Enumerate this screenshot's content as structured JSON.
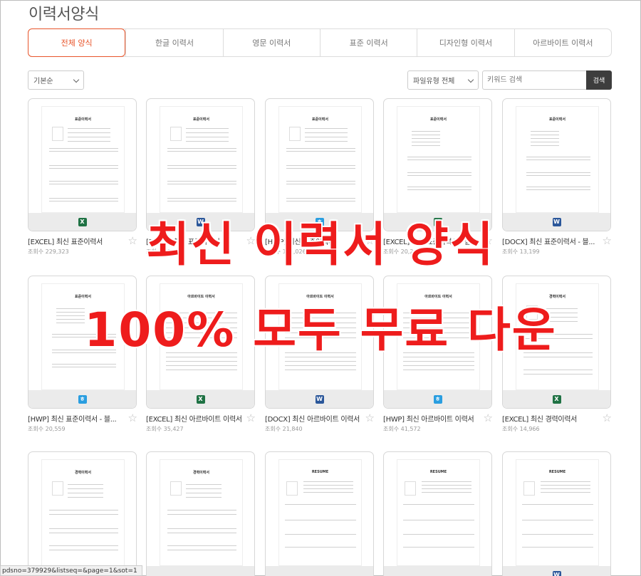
{
  "page": {
    "title": "이력서양식"
  },
  "tabs": [
    {
      "label": "전체 양식",
      "active": true
    },
    {
      "label": "한글 이력서",
      "active": false
    },
    {
      "label": "영문 이력서",
      "active": false
    },
    {
      "label": "표준 이력서",
      "active": false
    },
    {
      "label": "디자인형 이력서",
      "active": false
    },
    {
      "label": "아르바이트 이력서",
      "active": false
    }
  ],
  "controls": {
    "sort": "기본순",
    "file_type": "파일유형 전체",
    "search_placeholder": "키워드 검색",
    "search_button": "검색"
  },
  "colors": {
    "accent": "#e8552b",
    "excel": "#1f7244",
    "word": "#2b579a",
    "hwp": "#2a9ee0",
    "overlay": "#ee1c1c"
  },
  "cards": [
    {
      "title": "[EXCEL] 최신 표준이력서",
      "views": "조회수 229,323",
      "filetype": "excel",
      "doc_title": "표준이력서",
      "style": "std"
    },
    {
      "title": "[DOCX] 최신 표준이력서",
      "views": "조회수 115,",
      "filetype": "word",
      "doc_title": "표준이력서",
      "style": "std"
    },
    {
      "title": "[HWP] 최신 표준이력서",
      "views": "조회수 195,026",
      "filetype": "hwp",
      "doc_title": "표준이력서",
      "style": "std"
    },
    {
      "title": "[EXCEL] 최신 표준이력서 - 블",
      "views": "조회수 20,294",
      "filetype": "excel",
      "doc_title": "표준이력서",
      "style": "simple"
    },
    {
      "title": "[DOCX] 최신 표준이력서 - 블...",
      "views": "조회수 13,199",
      "filetype": "word",
      "doc_title": "표준이력서",
      "style": "simple"
    },
    {
      "title": "[HWP] 최신 표준이력서 - 블...",
      "views": "조회수 20,559",
      "filetype": "hwp",
      "doc_title": "표준이력서",
      "style": "simple"
    },
    {
      "title": "[EXCEL] 최신 아르바이트 이력서",
      "views": "조회수 35,427",
      "filetype": "excel",
      "doc_title": "아르바이트 이력서",
      "style": "table"
    },
    {
      "title": "[DOCX] 최신 아르바이트 이력서",
      "views": "조회수 21,840",
      "filetype": "word",
      "doc_title": "아르바이트 이력서",
      "style": "table"
    },
    {
      "title": "[HWP] 최신 아르바이트 이력서",
      "views": "조회수 41,572",
      "filetype": "hwp",
      "doc_title": "아르바이트 이력서",
      "style": "table"
    },
    {
      "title": "[EXCEL] 최신 경력이력서",
      "views": "조회수 14,966",
      "filetype": "excel",
      "doc_title": "경력이력서",
      "style": "career"
    },
    {
      "title": "",
      "views": "",
      "filetype": "",
      "doc_title": "경력이력서",
      "style": "career"
    },
    {
      "title": "",
      "views": "",
      "filetype": "",
      "doc_title": "경력이력서",
      "style": "career"
    },
    {
      "title": "",
      "views": "",
      "filetype": "",
      "doc_title": "RESUME",
      "style": "resume"
    },
    {
      "title": "",
      "views": "",
      "filetype": "",
      "doc_title": "RESUME",
      "style": "resume"
    },
    {
      "title": "",
      "views": "",
      "filetype": "word",
      "doc_title": "RESUME",
      "style": "resume"
    }
  ],
  "overlay": {
    "line1": "최신 이력서 양식",
    "line2": "100% 모두 무료 다운"
  },
  "status_url": "pdsno=379929&listseq=&page=1&sot=1"
}
